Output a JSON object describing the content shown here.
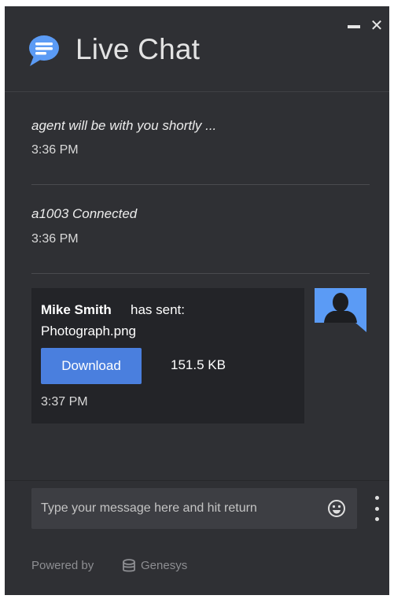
{
  "header": {
    "title": "Live Chat",
    "chat_icon": "chat-bubble-icon",
    "minimize_icon": "minimize-icon",
    "close_glyph": "✕"
  },
  "messages": [
    {
      "text": "agent will be with you shortly ...",
      "time": "3:36 PM"
    },
    {
      "text": "a1003 Connected",
      "time": "3:36 PM"
    }
  ],
  "file_message": {
    "sender": "Mike Smith",
    "action": "has sent:",
    "filename": "Photograph.png",
    "download_label": "Download",
    "size": "151.5 KB",
    "time": "3:37 PM",
    "avatar_icon": "user-avatar-icon"
  },
  "composer": {
    "placeholder": "Type your message here and hit return",
    "emoji_icon": "emoji-icon",
    "menu_icon": "more-vertical-icon"
  },
  "footer": {
    "powered_by": "Powered by",
    "brand": "Genesys",
    "brand_icon": "genesys-logo-icon"
  },
  "colors": {
    "panel": "#2f3034",
    "card": "#232428",
    "accent": "#4a7fde",
    "icon_blue": "#5b9bf5"
  }
}
